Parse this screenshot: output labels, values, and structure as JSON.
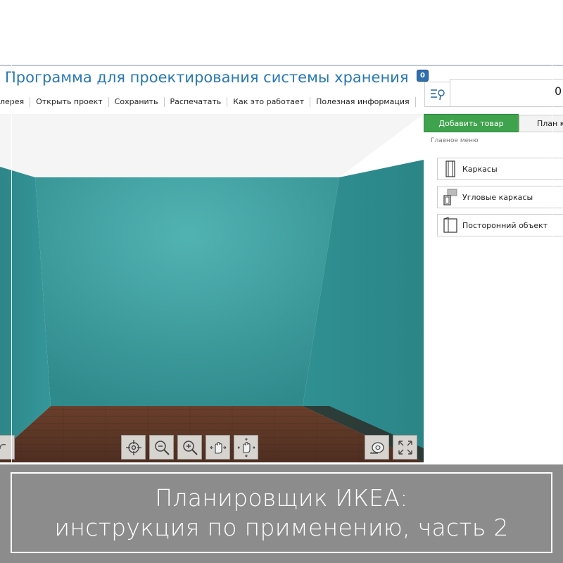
{
  "app": {
    "title": "Программа для проектирования системы хранения"
  },
  "menu": {
    "items": [
      "лерея",
      "Открыть проект",
      "Сохранить",
      "Распечатать",
      "Как это работает",
      "Полезная информация"
    ]
  },
  "panel": {
    "badge": "0",
    "count": "0",
    "tabs": {
      "add": "Добавить товар",
      "plan": "План к"
    },
    "section_label": "Главное меню",
    "categories": [
      {
        "label": "Каркасы",
        "icon": "frame-icon"
      },
      {
        "label": "Угловые каркасы",
        "icon": "corner-frame-icon"
      },
      {
        "label": "Посторонний объект",
        "icon": "foreign-object-icon"
      }
    ]
  },
  "view_controls": [
    {
      "name": "center-view-button",
      "icon": "target-icon"
    },
    {
      "name": "zoom-out-button",
      "icon": "zoom-out-icon"
    },
    {
      "name": "zoom-in-button",
      "icon": "zoom-in-icon"
    },
    {
      "name": "pan-button",
      "icon": "hand-pan-icon"
    },
    {
      "name": "rotate-button",
      "icon": "hand-rotate-icon"
    }
  ],
  "colors": {
    "wall": "#3a9a9c",
    "floor": "#5a3626",
    "title": "#2878b8",
    "add_tab": "#3fa34d",
    "caption_bg": "#8c8c8c"
  },
  "caption": {
    "line1": "Планировщик ИКЕА:",
    "line2": "инструкция по применению, часть 2"
  }
}
